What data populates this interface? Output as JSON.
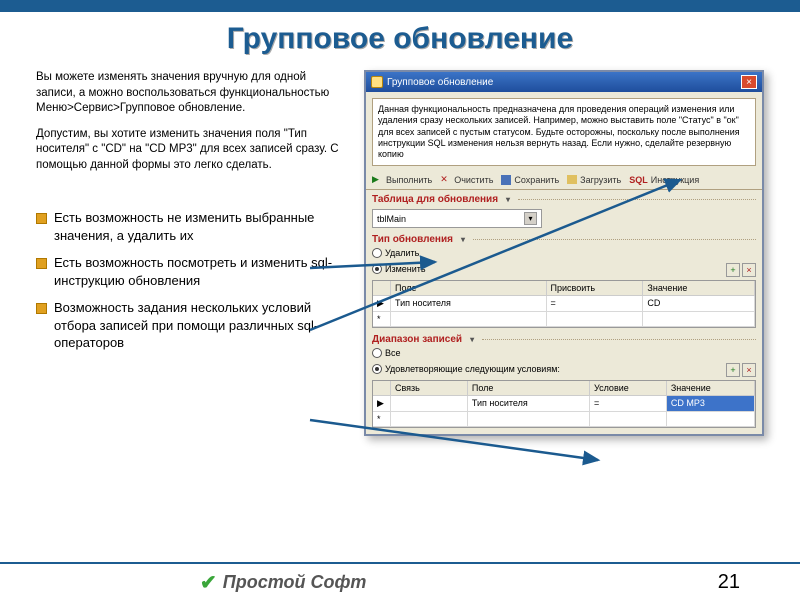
{
  "slide": {
    "title": "Групповое обновление",
    "intro1": "Вы можете изменять значения вручную для одной записи, а можно воспользоваться функциональностью Меню>Сервис>Групповое обновление.",
    "intro2": "Допустим, вы хотите изменить значения поля \"Тип носителя\" с \"CD\" на \"CD MP3\" для всех записей сразу. С помощью данной формы это легко сделать."
  },
  "bullets": [
    "Есть возможность не изменить выбранные значения, а удалить их",
    "Есть возможность посмотреть и изменить sql-инструкцию обновления",
    "Возможность задания нескольких условий отбора записей при помощи различных sql-операторов"
  ],
  "win": {
    "title": "Групповое обновление",
    "info": "Данная функциональность предназначена для проведения операций изменения или удаления сразу нескольких записей. Например, можно выставить поле \"Статус\" в \"ок\" для всех записей с пустым статусом. Будьте осторожны, поскольку после выполнения инструкции SQL изменения нельзя вернуть назад. Если нужно, сделайте резервную копию",
    "toolbar": {
      "run": "Выполнить",
      "clear": "Очистить",
      "save": "Сохранить",
      "load": "Загрузить",
      "sql": "SQL",
      "instr": "Инструкция"
    },
    "sec_table": "Таблица для обновления",
    "combo_value": "tblMain",
    "sec_type": "Тип обновления",
    "radio_del": "Удалить",
    "radio_upd": "Изменить",
    "grid1": {
      "h1": "Поле",
      "h2": "Присвоить",
      "h3": "Значение",
      "r_field": "Тип носителя",
      "r_op": "=",
      "r_val": "CD"
    },
    "sec_range": "Диапазон записей",
    "radio_all": "Все",
    "radio_cond": "Удовлетворяющие следующим условиям:",
    "grid2": {
      "h0": "Связь",
      "h1": "Поле",
      "h2": "Условие",
      "h3": "Значение",
      "r_field": "Тип носителя",
      "r_op": "=",
      "r_val": "CD MP3"
    }
  },
  "footer": {
    "brand": "Простой Софт",
    "page": "21"
  }
}
